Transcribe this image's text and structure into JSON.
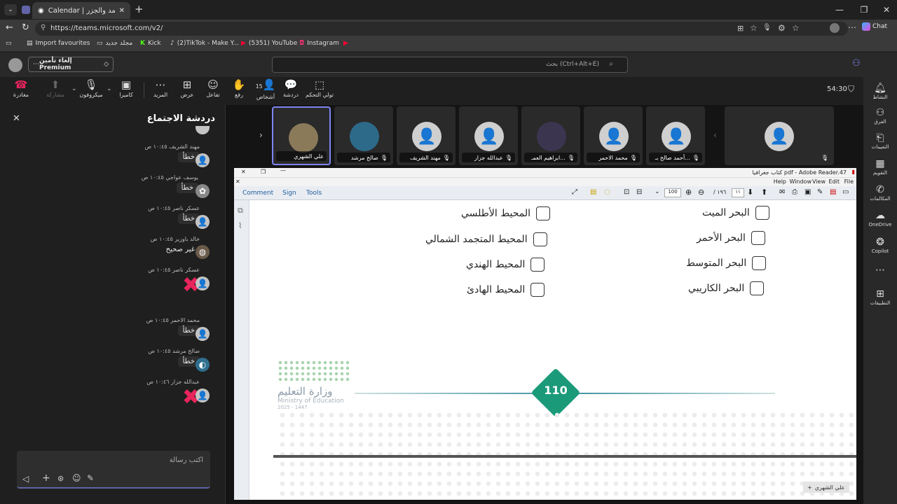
{
  "browser": {
    "tabs": [
      {
        "label": "Calendar | الأمواج والمد والجزر",
        "active": true
      }
    ],
    "new_tab": "+",
    "url": "https://teams.microsoft.com/v2/",
    "chat_btn": "Chat",
    "bookmarks": [
      "Import favourites",
      "مجلد جديد",
      "Kick",
      "(2)TikTok - Make Y...",
      "(5351) YouTube",
      "Instagram"
    ]
  },
  "teams": {
    "premium": "إلغاء تأمين Premium",
    "search_placeholder": "بحث (Ctrl+Alt+E)",
    "toolbar": {
      "leave": "مغادرة",
      "share": "مشاركة",
      "mic": "ميكروفون",
      "camera": "كاميرا",
      "more": "المزيد",
      "view": "عرض",
      "react": "تفاعل",
      "raise": "رفع",
      "people": "أشخاص",
      "people_count": "15",
      "chat": "دردشة",
      "control": "تولي التحكم"
    },
    "timer": "54:30",
    "rail": [
      "النشاط",
      "الفرق",
      "التعيينات",
      "التقويم",
      "المكالمات",
      "OneDrive",
      "Copilot",
      "التطبيقات"
    ]
  },
  "chat": {
    "title": "دردشة الاجتماع",
    "messages": [
      {
        "name": "مهند الشريف",
        "time": "١٠:٤٥ ص",
        "text": "خطأ"
      },
      {
        "name": "يوسف عواجي",
        "time": "١٠:٤٥ ص",
        "text": "خطأ"
      },
      {
        "name": "عسكر ناصر",
        "time": "١٠:٤٥ ص",
        "text": "خطأ"
      },
      {
        "name": "خالد باوزير",
        "time": "١٠:٤٥ ص",
        "text": "غير صحيح"
      },
      {
        "name": "عسكر ناصر",
        "time": "١٠:٤٥ ص",
        "text": "✖"
      },
      {
        "name": "محمد الاحمر",
        "time": "١٠:٤٥ ص",
        "text": "خطأ"
      },
      {
        "name": "صالح مرشد",
        "time": "١٠:٤٥ ص",
        "text": "خطأ"
      },
      {
        "name": "عبدالله جزار",
        "time": "١٠:٤٦ ص",
        "text": "✖"
      }
    ],
    "composer_placeholder": "اكتب رسالة"
  },
  "participants": [
    {
      "name": "علي الشهري",
      "active": true
    },
    {
      "name": "صالح مرشد"
    },
    {
      "name": "مهند الشريف"
    },
    {
      "name": "عبدالله جزار"
    },
    {
      "name": "ابراهيم العمـ..."
    },
    {
      "name": "محمد الاحمر"
    },
    {
      "name": "أحمد صالح بـ..."
    },
    {
      "name": ""
    }
  ],
  "adobe": {
    "title": "كتاب جغرافيا pdf - Adobe Reader.47",
    "menus": [
      "Help",
      "Window",
      "View",
      "Edit",
      "File"
    ],
    "tabs": [
      "Comment",
      "Sign",
      "Tools"
    ],
    "zoom": "100",
    "page_total": "/ ١٩٦",
    "page_current": "١١",
    "options_right": [
      "البحر الميت",
      "البحر الأحمر",
      "البحر المتوسط",
      "البحر الكاريبي"
    ],
    "options_left": [
      "المحيط الأطلسي",
      "المحيط المتجمد الشمالي",
      "المحيط الهندي",
      "المحيط الهادئ"
    ],
    "page_number": "110",
    "ministry_ar": "وزارة التعليم",
    "ministry_en": "Ministry of Education",
    "ministry_year": "2025 - 1447",
    "presenter": "علي الشهري"
  }
}
